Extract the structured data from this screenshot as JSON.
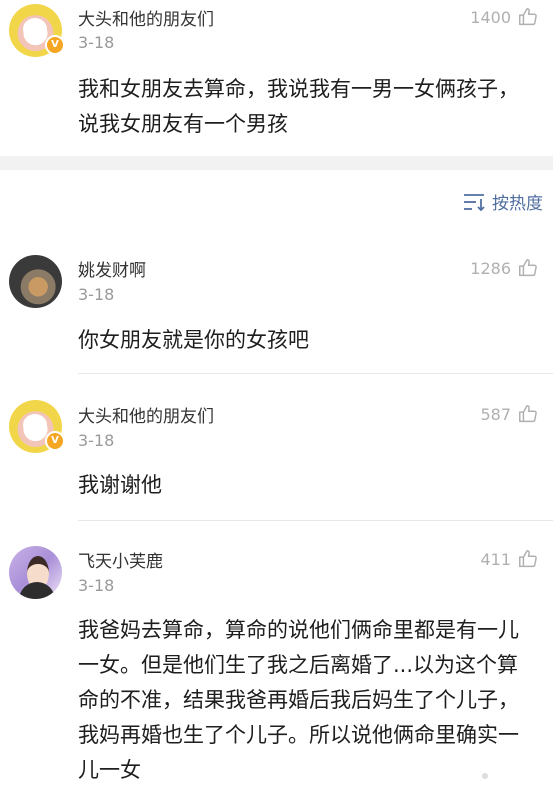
{
  "post": {
    "username": "大头和他的朋友们",
    "date": "3-18",
    "likes": "1400",
    "text": "我和女朋友去算命，我说我有一男一女俩孩子，说我女朋友有一个男孩"
  },
  "sort": {
    "label": "按热度"
  },
  "comments": [
    {
      "username": "姚发财啊",
      "date": "3-18",
      "likes": "1286",
      "text": "你女朋友就是你的女孩吧"
    },
    {
      "username": "大头和他的朋友们",
      "date": "3-18",
      "likes": "587",
      "text": "我谢谢他"
    },
    {
      "username": "飞天小芙鹿",
      "date": "3-18",
      "likes": "411",
      "text": "我爸妈去算命，算命的说他们俩命里都是有一儿一女。但是他们生了我之后离婚了...以为这个算命的不准，结果我爸再婚后我后妈生了个儿子，我妈再婚也生了个儿子。所以说他俩命里确实一儿一女"
    }
  ],
  "badges": {
    "verified": "V"
  },
  "colors": {
    "accent": "#506fa0",
    "badge": "#f5a623",
    "band": "#f2f2f2"
  },
  "icons": [
    "thumbs-up-icon",
    "sort-icon",
    "verified-badge-icon"
  ]
}
